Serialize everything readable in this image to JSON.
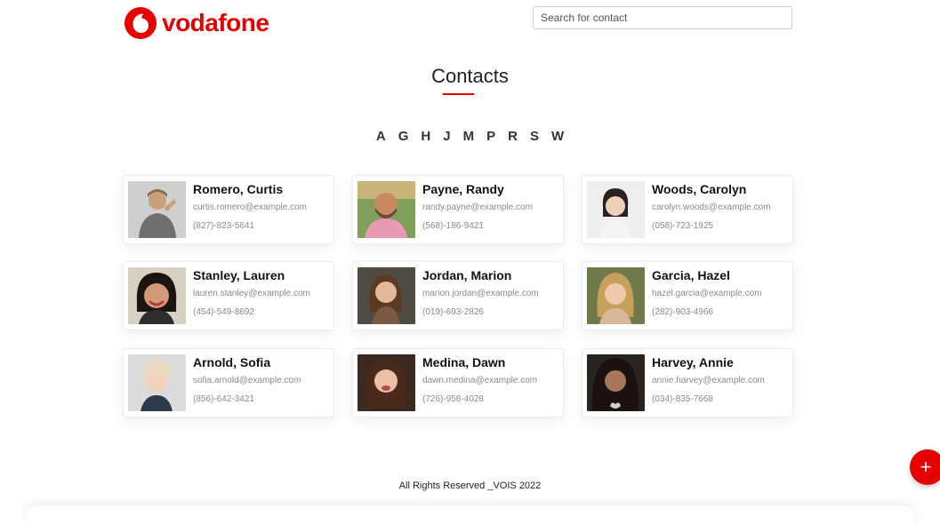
{
  "brand": {
    "name": "vodafone",
    "color": "#e60000"
  },
  "search": {
    "placeholder": "Search for contact",
    "value": ""
  },
  "page_title": "Contacts",
  "letters": [
    "A",
    "G",
    "H",
    "J",
    "M",
    "P",
    "R",
    "S",
    "W"
  ],
  "contacts": [
    {
      "name": "Romero, Curtis",
      "email": "curtis.romero@example.com",
      "phone": "(827)-823-5641"
    },
    {
      "name": "Payne, Randy",
      "email": "randy.payne@example.com",
      "phone": "(568)-186-9421"
    },
    {
      "name": "Woods, Carolyn",
      "email": "carolyn.woods@example.com",
      "phone": "(058)-723-1925"
    },
    {
      "name": "Stanley, Lauren",
      "email": "lauren.stanley@example.com",
      "phone": "(454)-549-8692"
    },
    {
      "name": "Jordan, Marion",
      "email": "marion.jordan@example.com",
      "phone": "(019)-693-2826"
    },
    {
      "name": "Garcia, Hazel",
      "email": "hazel.garcia@example.com",
      "phone": "(282)-903-4966"
    },
    {
      "name": "Arnold, Sofia",
      "email": "sofia.arnold@example.com",
      "phone": "(856)-642-3421"
    },
    {
      "name": "Medina, Dawn",
      "email": "dawn.medina@example.com",
      "phone": "(726)-958-4028"
    },
    {
      "name": "Harvey, Annie",
      "email": "annie.harvey@example.com",
      "phone": "(034)-835-7668"
    }
  ],
  "footer": "All Rights Reserved _VOIS 2022",
  "fab": {
    "icon": "plus-icon",
    "label": "+"
  }
}
